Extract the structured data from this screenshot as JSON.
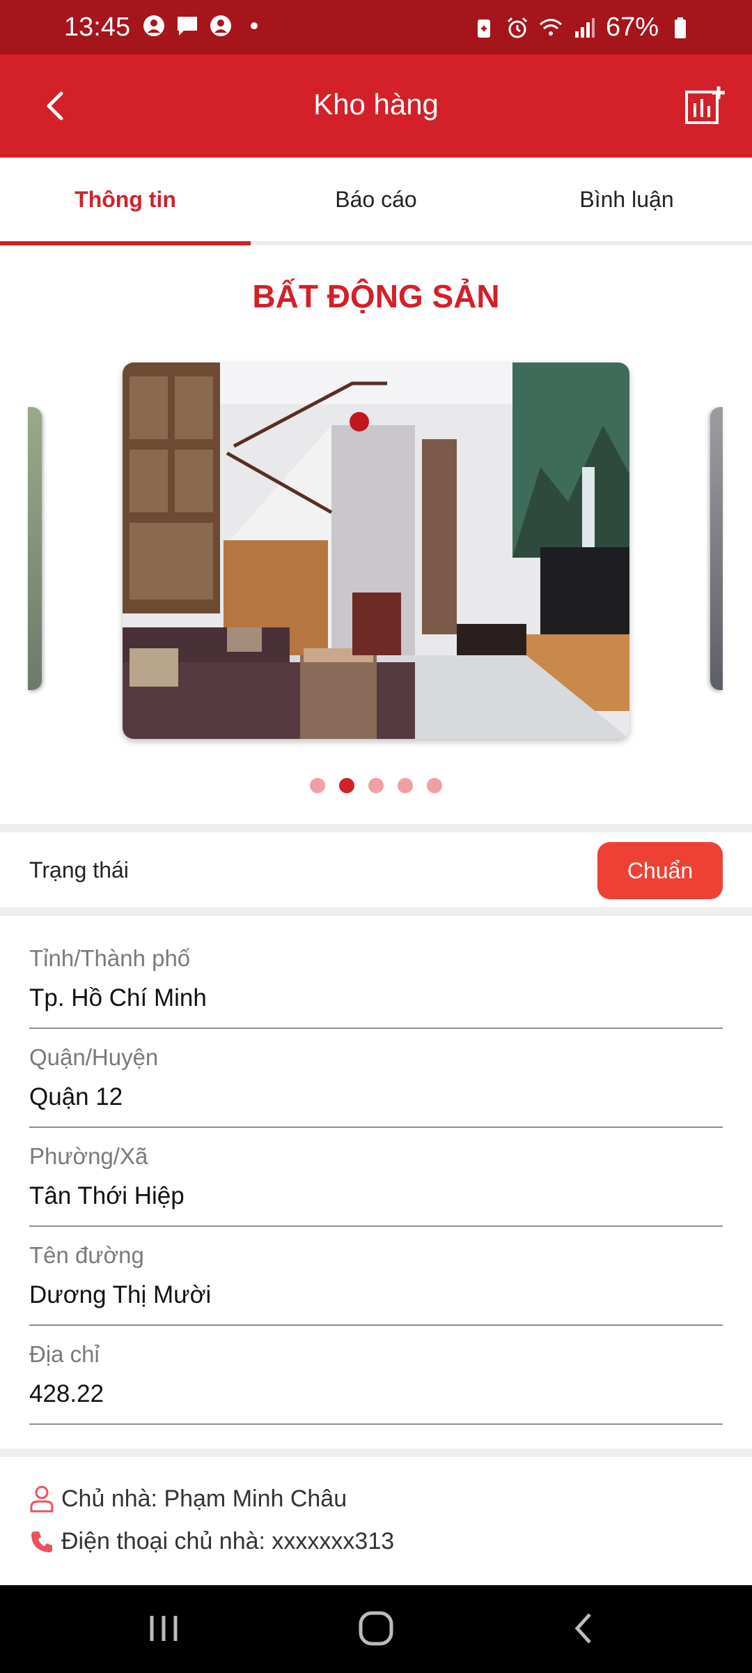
{
  "status_bar": {
    "time": "13:45",
    "battery": "67%",
    "icons": [
      "person-circle-icon",
      "chat-icon",
      "person-circle-icon",
      "dot-icon",
      "battery-saver-icon",
      "alarm-icon",
      "wifi-icon",
      "signal-icon",
      "battery-icon"
    ]
  },
  "app_bar": {
    "title": "Kho hàng",
    "back_icon": "chevron-left-icon",
    "action_icon": "add-report-icon"
  },
  "tabs": [
    {
      "label": "Thông tin",
      "active": true
    },
    {
      "label": "Báo cáo",
      "active": false
    },
    {
      "label": "Bình luận",
      "active": false
    }
  ],
  "section_title": "BẤT ĐỘNG SẢN",
  "carousel": {
    "slide_count": 5,
    "active_index": 1
  },
  "status": {
    "label": "Trạng thái",
    "value": "Chuẩn"
  },
  "fields": [
    {
      "label": "Tỉnh/Thành phố",
      "value": "Tp. Hồ Chí Minh"
    },
    {
      "label": "Quận/Huyện",
      "value": "Quận 12"
    },
    {
      "label": "Phường/Xã",
      "value": "Tân Thới Hiệp"
    },
    {
      "label": "Tên đường",
      "value": "Dương Thị Mười"
    },
    {
      "label": "Địa chỉ",
      "value": "428.22"
    }
  ],
  "owner": {
    "name_text": "Chủ nhà: Phạm Minh Châu",
    "phone_text": "Điện thoại chủ nhà: xxxxxxx313"
  },
  "colors": {
    "primary": "#d32029",
    "status_bar": "#a6141c",
    "badge": "#ee4035",
    "dot_inactive": "#f0a0a4"
  }
}
